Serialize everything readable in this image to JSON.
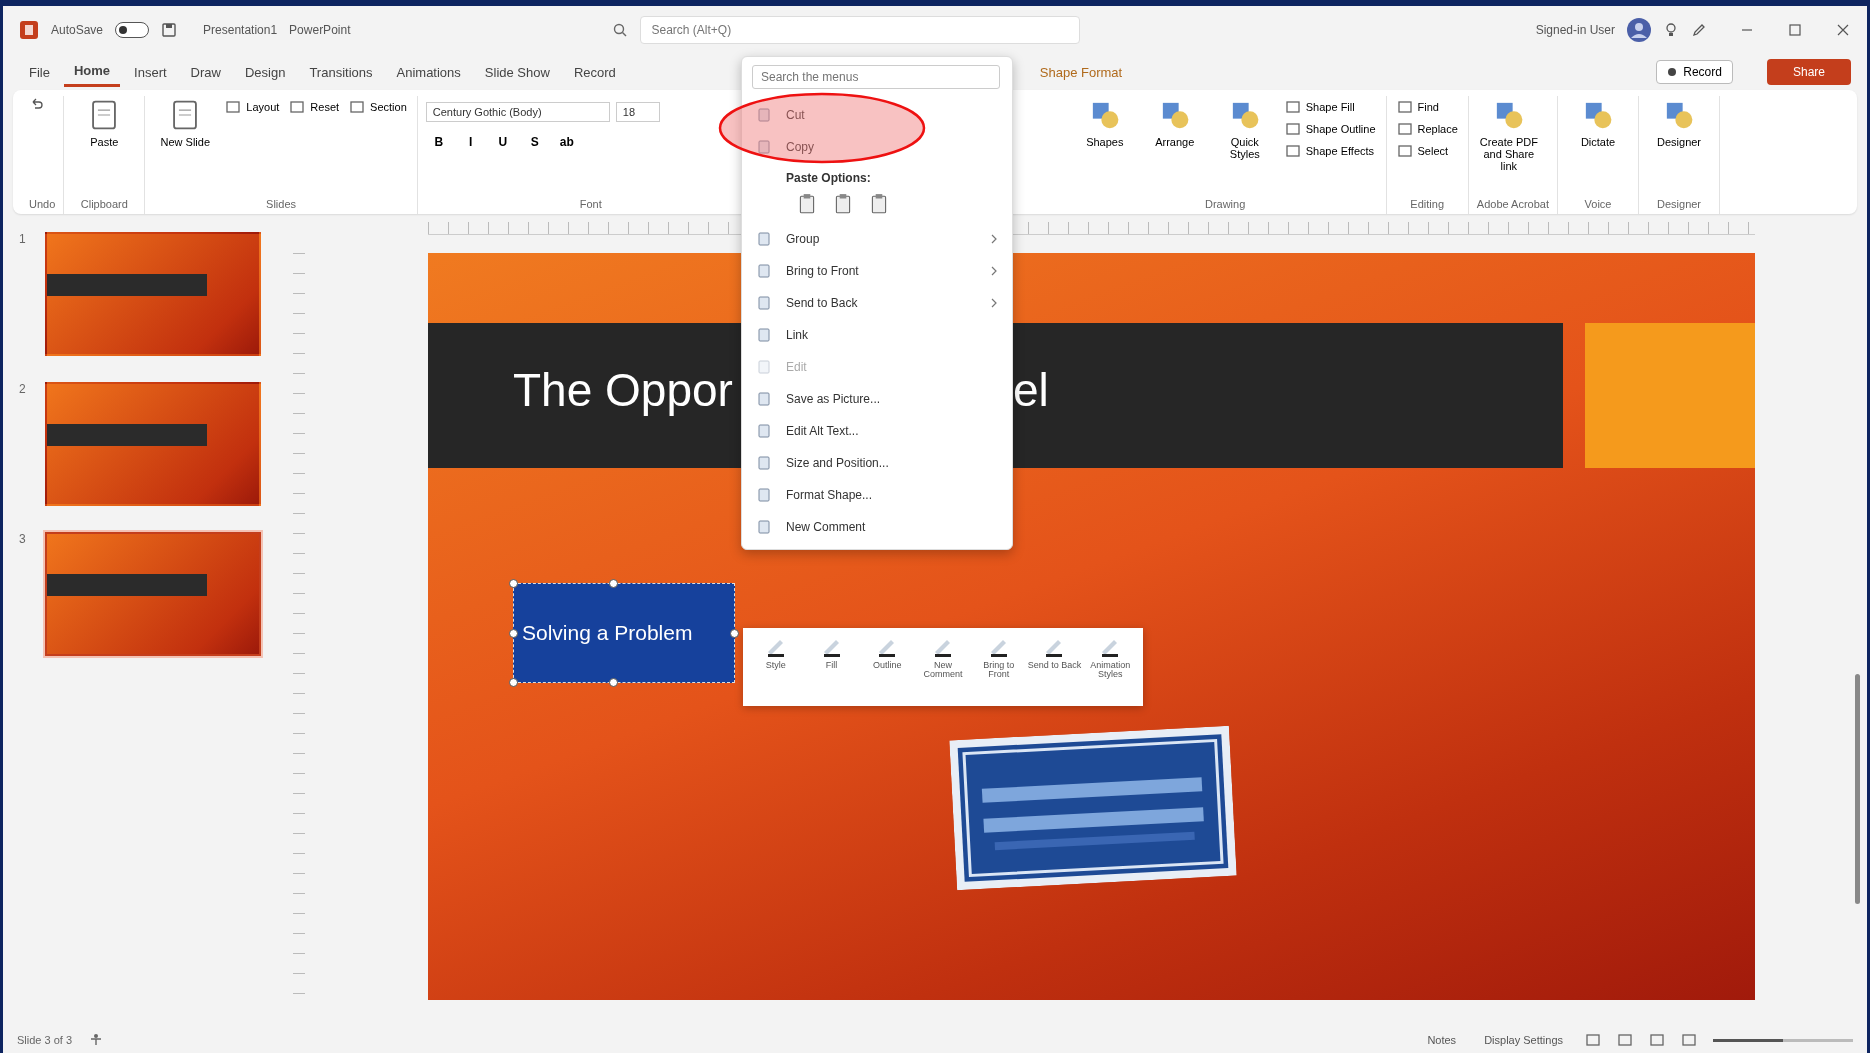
{
  "title_bar": {
    "autosave": "AutoSave",
    "autosave_on": false,
    "file_name": "Presentation1",
    "app_name": "PowerPoint",
    "search": {
      "placeholder": "Search (Alt+Q)"
    },
    "user": "Signed-in User"
  },
  "tabs": [
    {
      "label": "File",
      "selected": false
    },
    {
      "label": "Home",
      "selected": true
    },
    {
      "label": "Insert",
      "selected": false
    },
    {
      "label": "Draw",
      "selected": false
    },
    {
      "label": "Design",
      "selected": false
    },
    {
      "label": "Transitions",
      "selected": false
    },
    {
      "label": "Animations",
      "selected": false
    },
    {
      "label": "Slide Show",
      "selected": false
    },
    {
      "label": "Record",
      "selected": false
    },
    {
      "label": "Shape Format",
      "selected": false,
      "kind": "contextual"
    }
  ],
  "record_button": "Record",
  "share_button": "Share",
  "ribbon_left": [
    {
      "label": "Undo"
    },
    {
      "label": "Clipboard",
      "buttons": [
        {
          "label": "Paste",
          "kind": "large"
        }
      ]
    },
    {
      "label": "Slides",
      "buttons": [
        {
          "label": "New Slide",
          "kind": "large"
        },
        {
          "label": "Layout",
          "kind": "small"
        },
        {
          "label": "Reset",
          "kind": "small"
        },
        {
          "label": "Section",
          "kind": "small"
        }
      ]
    }
  ],
  "font": {
    "label": "Font",
    "name": "Century Gothic (Body)",
    "size": "18",
    "format_buttons": [
      "B",
      "I",
      "U",
      "S",
      "ab"
    ]
  },
  "ribbon_right": [
    {
      "label": "Drawing",
      "buttons": [
        {
          "label": "Shapes",
          "kind": "large"
        },
        {
          "label": "Arrange",
          "kind": "large"
        },
        {
          "label": "Quick Styles",
          "kind": "large"
        },
        {
          "label": "Shape Fill",
          "kind": "small"
        },
        {
          "label": "Shape Outline",
          "kind": "small"
        },
        {
          "label": "Shape Effects",
          "kind": "small"
        }
      ]
    },
    {
      "label": "Editing",
      "buttons": [
        {
          "label": "Find",
          "kind": "small"
        },
        {
          "label": "Replace",
          "kind": "small"
        },
        {
          "label": "Select",
          "kind": "small"
        }
      ]
    },
    {
      "label": "Adobe Acrobat",
      "buttons": [
        {
          "label": "Create PDF and Share link",
          "kind": "large"
        }
      ]
    },
    {
      "label": "Voice",
      "buttons": [
        {
          "label": "Dictate",
          "kind": "large"
        }
      ]
    },
    {
      "label": "Designer",
      "buttons": [
        {
          "label": "Designer",
          "kind": "large"
        }
      ]
    }
  ],
  "thumbnails": [
    {
      "number": "1",
      "selected": false
    },
    {
      "number": "2",
      "selected": false
    },
    {
      "number": "3",
      "selected": true
    }
  ],
  "slide": {
    "title_start": "The Oppor",
    "title_end": "el",
    "text_box": "Solving a Problem"
  },
  "context_menu": {
    "search": {
      "placeholder": "Search the menus"
    },
    "items": [
      {
        "kind": "item",
        "label": "Cut",
        "disabled": false,
        "submenu": false
      },
      {
        "kind": "item",
        "label": "Copy",
        "disabled": false,
        "submenu": false
      },
      {
        "kind": "header",
        "label": "Paste Options:"
      },
      {
        "kind": "paste-icons"
      },
      {
        "kind": "item",
        "label": "Group",
        "disabled": false,
        "submenu": true
      },
      {
        "kind": "item",
        "label": "Bring to Front",
        "disabled": false,
        "submenu": true
      },
      {
        "kind": "item",
        "label": "Send to Back",
        "disabled": false,
        "submenu": true
      },
      {
        "kind": "item",
        "label": "Link",
        "disabled": false,
        "submenu": false
      },
      {
        "kind": "item",
        "label": "Edit",
        "disabled": true,
        "submenu": false
      },
      {
        "kind": "item",
        "label": "Save as Picture...",
        "disabled": false,
        "submenu": false
      },
      {
        "kind": "item",
        "label": "Edit Alt Text...",
        "disabled": false,
        "submenu": false
      },
      {
        "kind": "item",
        "label": "Size and Position...",
        "disabled": false,
        "submenu": false
      },
      {
        "kind": "item",
        "label": "Format Shape...",
        "disabled": false,
        "submenu": false
      },
      {
        "kind": "item",
        "label": "New Comment",
        "disabled": false,
        "submenu": false
      }
    ]
  },
  "mini_toolbar": [
    {
      "label": "Style"
    },
    {
      "label": "Fill"
    },
    {
      "label": "Outline"
    },
    {
      "label": "New Comment"
    },
    {
      "label": "Bring to Front"
    },
    {
      "label": "Send to Back"
    },
    {
      "label": "Animation Styles"
    }
  ],
  "status_bar": {
    "slide_count": "Slide 3 of 3",
    "notes": "Notes",
    "display_settings": "Display Settings",
    "zoom": {
      "level": 0.5
    }
  }
}
